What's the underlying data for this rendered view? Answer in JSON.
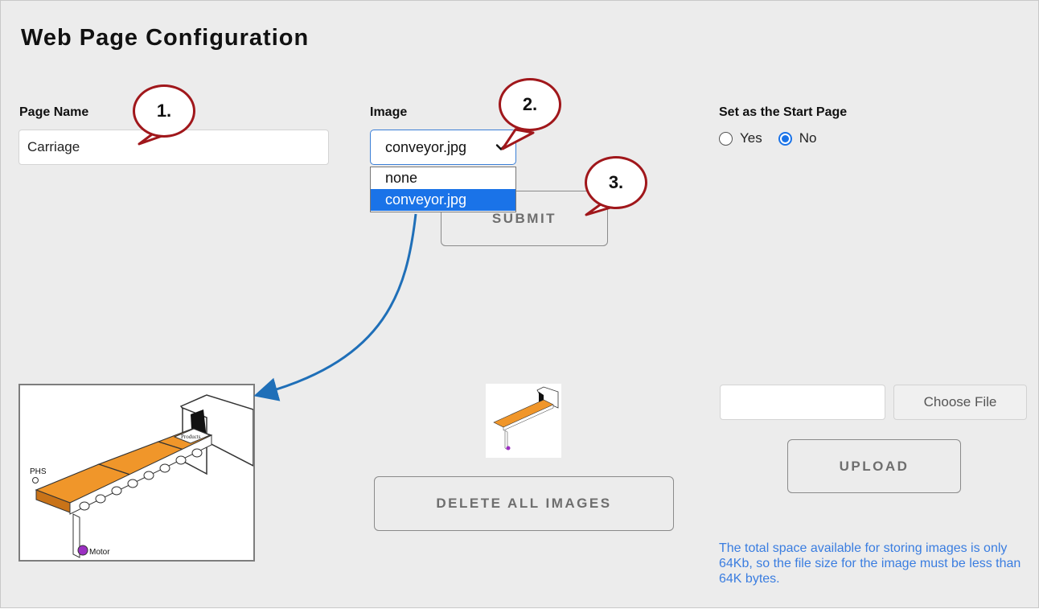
{
  "page": {
    "title": "Web Page Configuration"
  },
  "page_name": {
    "label": "Page Name",
    "value": "Carriage"
  },
  "image_select": {
    "label": "Image",
    "selected": "conveyor.jpg",
    "options": [
      "none",
      "conveyor.jpg"
    ]
  },
  "start_page": {
    "label": "Set as the Start Page",
    "yes_label": "Yes",
    "no_label": "No",
    "selected": "No"
  },
  "buttons": {
    "submit": "SUBMIT",
    "delete_all": "DELETE ALL IMAGES",
    "choose_file": "Choose File",
    "upload": "UPLOAD"
  },
  "file_input": {
    "value": ""
  },
  "note": "The total space available for storing images is only 64Kb, so the file size for the image must be less than 64K bytes.",
  "callouts": [
    "1.",
    "2.",
    "3."
  ],
  "preview": {
    "image_name": "conveyor.jpg",
    "labels": {
      "sensor": "PHS",
      "products": "Products",
      "motor": "Motor"
    }
  },
  "colors": {
    "panel_bg": "#ececec",
    "accent": "#1a73e8",
    "callout_border": "#a0171b",
    "arrow": "#1f6fb8",
    "note_text": "#3a7de0",
    "belt": "#f0962a"
  }
}
